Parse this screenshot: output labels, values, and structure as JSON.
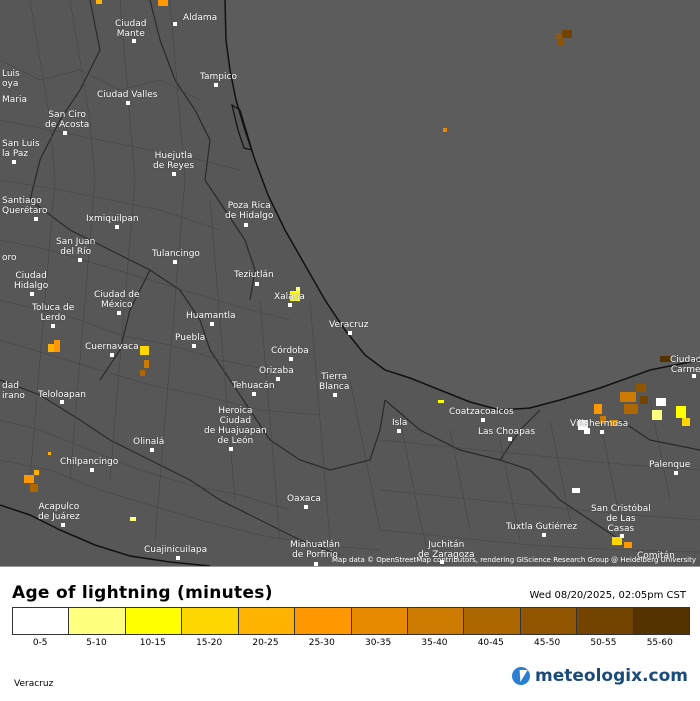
{
  "map": {
    "attribution": "Map data © OpenStreetMap contributors, rendering GIScience Research Group @ Heidelberg University",
    "cities": [
      {
        "id": "aldama",
        "lines": [
          "Aldama"
        ]
      },
      {
        "id": "ciudad-mante",
        "lines": [
          "Ciudad",
          "Mante"
        ]
      },
      {
        "id": "tampico",
        "lines": [
          "Tampico"
        ]
      },
      {
        "id": "luis-moya",
        "lines": [
          "Luis",
          "oya"
        ]
      },
      {
        "id": "maria",
        "lines": [
          "Maria"
        ]
      },
      {
        "id": "ciudad-valles",
        "lines": [
          "Ciudad Valles"
        ]
      },
      {
        "id": "san-ciro",
        "lines": [
          "San Ciro",
          "de Acosta"
        ]
      },
      {
        "id": "san-luis-la-paz",
        "lines": [
          "San Luis",
          "la Paz"
        ]
      },
      {
        "id": "huejutla",
        "lines": [
          "Huejutla",
          "de Reyes"
        ]
      },
      {
        "id": "poza-rica",
        "lines": [
          "Poza Rica",
          "de Hidalgo"
        ]
      },
      {
        "id": "santiago-queretaro",
        "lines": [
          "Santiago",
          "Querétaro"
        ]
      },
      {
        "id": "ixmiquilpan",
        "lines": [
          "Ixmiquilpan"
        ]
      },
      {
        "id": "san-juan-del-rio",
        "lines": [
          "San Juan",
          "del Río"
        ]
      },
      {
        "id": "tulancingo",
        "lines": [
          "Tulancingo"
        ]
      },
      {
        "id": "teziutlan",
        "lines": [
          "Teziutlán"
        ]
      },
      {
        "id": "ciudad-hidalgo",
        "lines": [
          "Ciudad",
          "Hidalgo"
        ]
      },
      {
        "id": "ciudad-de-mexico",
        "lines": [
          "Ciudad de",
          "México"
        ]
      },
      {
        "id": "toluca",
        "lines": [
          "Toluca de",
          "Lerdo"
        ]
      },
      {
        "id": "xalapa",
        "lines": [
          "Xalapa"
        ]
      },
      {
        "id": "huamantla",
        "lines": [
          "Huamantla"
        ]
      },
      {
        "id": "veracruz",
        "lines": [
          "Veracruz"
        ]
      },
      {
        "id": "puebla",
        "lines": [
          "Puebla"
        ]
      },
      {
        "id": "cuernavaca",
        "lines": [
          "Cuernavaca"
        ]
      },
      {
        "id": "cordoba",
        "lines": [
          "Córdoba"
        ]
      },
      {
        "id": "orizaba",
        "lines": [
          "Orizaba"
        ]
      },
      {
        "id": "tierra-blanca",
        "lines": [
          "Tierra",
          "Blanca"
        ]
      },
      {
        "id": "tehuacan",
        "lines": [
          "Tehuacán"
        ]
      },
      {
        "id": "teloloapan",
        "lines": [
          "Teloloapan"
        ]
      },
      {
        "id": "heroica-huajuapan",
        "lines": [
          "Heroica",
          "Ciudad",
          "de Huajuapan",
          "de León"
        ]
      },
      {
        "id": "isla",
        "lines": [
          "Isla"
        ]
      },
      {
        "id": "coatzacoalcos",
        "lines": [
          "Coatzacoalcos"
        ]
      },
      {
        "id": "las-choapas",
        "lines": [
          "Las Choapas"
        ]
      },
      {
        "id": "villahermosa",
        "lines": [
          "Villahermosa"
        ]
      },
      {
        "id": "olinala",
        "lines": [
          "Olinalá"
        ]
      },
      {
        "id": "chilpancingo",
        "lines": [
          "Chilpancingo"
        ]
      },
      {
        "id": "palenque",
        "lines": [
          "Palenque"
        ]
      },
      {
        "id": "acapulco",
        "lines": [
          "Acapulco",
          "de Juárez"
        ]
      },
      {
        "id": "oaxaca",
        "lines": [
          "Oaxaca"
        ]
      },
      {
        "id": "tuxtla",
        "lines": [
          "Tuxtla Gutiérrez"
        ]
      },
      {
        "id": "san-cristobal",
        "lines": [
          "San Cristóbal",
          "de Las",
          "Casas"
        ]
      },
      {
        "id": "cuajinicuilapa",
        "lines": [
          "Cuajinicuilapa"
        ]
      },
      {
        "id": "miahuatlan",
        "lines": [
          "Miahuatlán",
          "de Porfirio"
        ]
      },
      {
        "id": "juchitan",
        "lines": [
          "Juchitán",
          "de Zaragoza"
        ]
      },
      {
        "id": "ciudad-del-carmen",
        "lines": [
          "Ciudad",
          "Carme"
        ]
      },
      {
        "id": "comitan",
        "lines": [
          "Comitán"
        ]
      },
      {
        "id": "dad-irano",
        "lines": [
          "dad",
          "irano"
        ]
      },
      {
        "id": "oro",
        "lines": [
          "oro"
        ]
      }
    ]
  },
  "legend": {
    "title": "Age of lightning (minutes)",
    "timestamp": "Wed 08/20/2025, 02:05pm CST",
    "bins": [
      {
        "label": "0-5",
        "color": "#ffffff"
      },
      {
        "label": "5-10",
        "color": "#ffff80"
      },
      {
        "label": "10-15",
        "color": "#ffff00"
      },
      {
        "label": "15-20",
        "color": "#ffd700"
      },
      {
        "label": "20-25",
        "color": "#ffb300"
      },
      {
        "label": "25-30",
        "color": "#ff9800"
      },
      {
        "label": "30-35",
        "color": "#e88a00"
      },
      {
        "label": "35-40",
        "color": "#cc7a00"
      },
      {
        "label": "40-45",
        "color": "#ad6700"
      },
      {
        "label": "45-50",
        "color": "#915500"
      },
      {
        "label": "50-55",
        "color": "#734400"
      },
      {
        "label": "55-60",
        "color": "#553300"
      }
    ],
    "region": "Veracruz"
  },
  "brand": {
    "name": "meteologix.com"
  }
}
